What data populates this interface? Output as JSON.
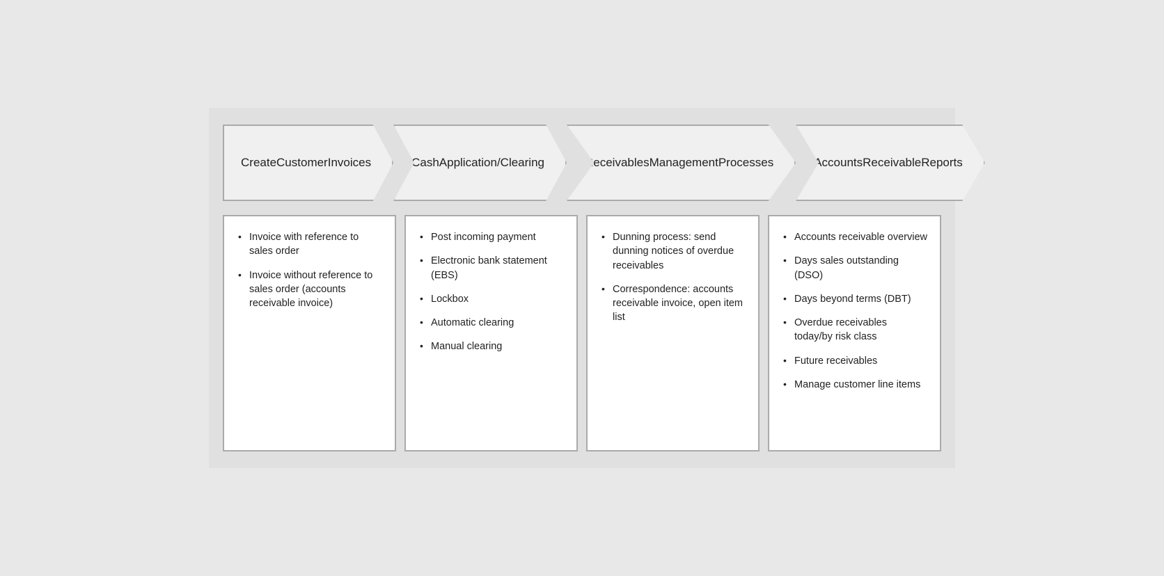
{
  "diagram": {
    "columns": [
      {
        "id": "col1",
        "header": "Create\nCustomer\nInvoices",
        "items": [
          "Invoice with reference to sales order",
          "Invoice without reference to sales order (accounts receivable invoice)"
        ]
      },
      {
        "id": "col2",
        "header": "Cash\nApplication/\nClearing",
        "items": [
          "Post incoming payment",
          "Electronic bank statement (EBS)",
          "Lockbox",
          "Automatic clearing",
          "Manual clearing"
        ]
      },
      {
        "id": "col3",
        "header": "Receivables\nManagement\nProcesses",
        "items": [
          "Dunning process: send dunning notices of overdue receivables",
          "Correspondence: accounts receivable invoice, open item list"
        ]
      },
      {
        "id": "col4",
        "header": "Accounts\nReceivable\nReports",
        "items": [
          "Accounts receivable overview",
          "Days sales outstanding (DSO)",
          "Days beyond terms (DBT)",
          "Overdue receivables today/by risk class",
          "Future receivables",
          "Manage customer line items"
        ]
      }
    ]
  }
}
